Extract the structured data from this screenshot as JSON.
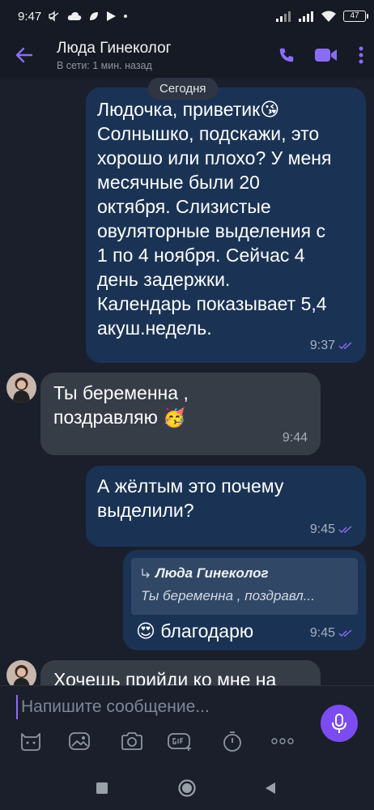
{
  "status_bar": {
    "time": "9:47",
    "battery": "47"
  },
  "header": {
    "title": "Люда Гинеколог",
    "subtitle": "В сети: 1 мин. назад"
  },
  "chat": {
    "date_divider": "Сегодня",
    "messages": [
      {
        "direction": "outgoing",
        "lines": [
          "Людочка, приветик😘",
          "Солнышко, подскажи, это",
          "хорошо или плохо? У меня",
          "месячные были 20",
          "октября. Слизистые",
          "овуляторные выделения с",
          "1 по 4 ноября. Сейчас 4",
          "день задержки.",
          "Календарь показывает 5,4",
          "акуш.недель."
        ],
        "time": "9:37",
        "status": "read"
      },
      {
        "direction": "incoming",
        "lines": [
          "Ты беременна ,",
          "поздравляю 🥳"
        ],
        "time": "9:44"
      },
      {
        "direction": "outgoing",
        "lines": [
          "А жёлтым это почему",
          "выделили?"
        ],
        "time": "9:45",
        "status": "read"
      },
      {
        "direction": "outgoing",
        "reply_to": {
          "author": "Люда Гинеколог",
          "text": "Ты беременна , поздравл..."
        },
        "lines": [
          "😍 благодарю"
        ],
        "time": "9:45",
        "status": "read"
      },
      {
        "direction": "incoming",
        "lines": [
          "Хочешь прийди ко мне на"
        ],
        "partially_visible": true
      }
    ]
  },
  "composer": {
    "placeholder": "Напишите сообщение...",
    "tools": [
      "sticker-icon",
      "gallery-icon",
      "camera-icon",
      "gif-icon",
      "timer-icon",
      "more-icon"
    ]
  },
  "colors": {
    "accent": "#8b6cf6",
    "mic": "#7c4cf0",
    "outgoing_bubble": "#1a3355",
    "incoming_bubble": "#373d47",
    "background": "#1a1f2b"
  }
}
